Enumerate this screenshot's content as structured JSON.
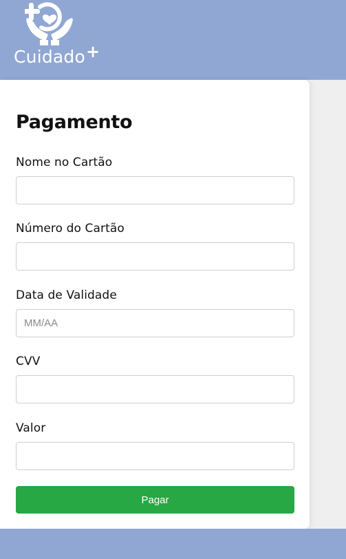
{
  "app": {
    "brand": "Cuidado",
    "brand_mark": "+",
    "colors": {
      "header_bg": "#91a7d3",
      "page_bg": "#efefef",
      "button_bg": "#28a745",
      "button_text": "#ffffff"
    }
  },
  "form": {
    "title": "Pagamento",
    "fields": [
      {
        "label": "Nome no Cartão",
        "value": "",
        "placeholder": ""
      },
      {
        "label": "Número do Cartão",
        "value": "",
        "placeholder": ""
      },
      {
        "label": "Data de Validade",
        "value": "",
        "placeholder": "MM/AA"
      },
      {
        "label": "CVV",
        "value": "",
        "placeholder": ""
      },
      {
        "label": "Valor",
        "value": "",
        "placeholder": ""
      }
    ],
    "submit_label": "Pagar"
  },
  "icons": {
    "logo": "hands-holding-heart-plus-icon"
  }
}
